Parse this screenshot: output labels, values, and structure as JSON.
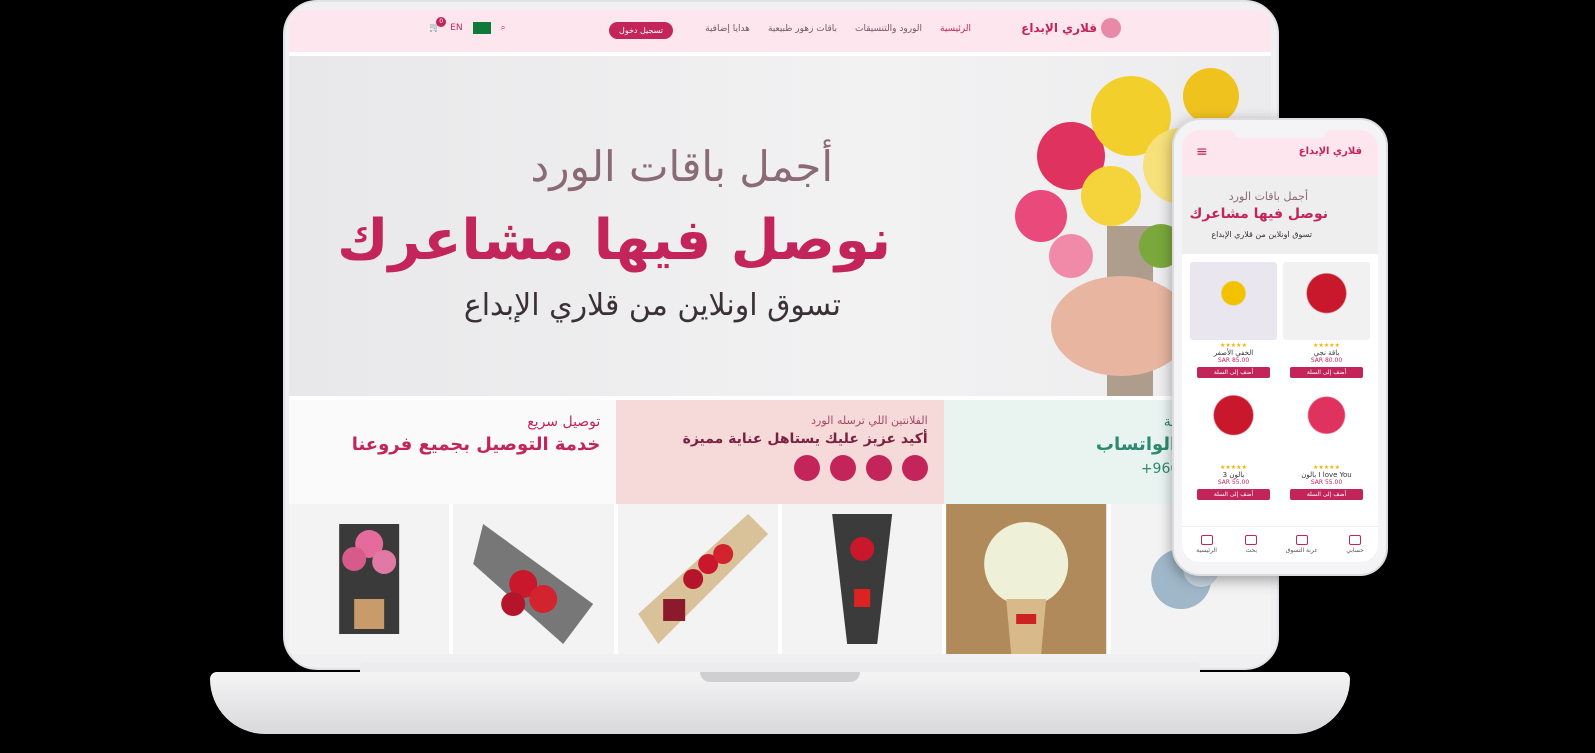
{
  "nav": {
    "logo": "قلاري الإبداع",
    "items": [
      "الرئيسية",
      "الورود والتنسيقات",
      "باقات زهور طبيعية",
      "هدايا إضافية"
    ],
    "register": "تسجيل دخول",
    "lang": "EN",
    "cart_count": "0"
  },
  "hero": {
    "line1": "أجمل باقات الورد",
    "line2": "نوصل فيها مشاعرك",
    "line3": "تسوق اونلاين من قلاري الإبداع"
  },
  "banners": [
    {
      "title": "توصيل سريع",
      "subtitle": "خدمة التوصيل بجميع فروعنا"
    },
    {
      "title": "الفلانتين اللي ترسله الورد",
      "subtitle": "أكيد عزيز عليك يستاهل عناية مميزة"
    },
    {
      "title": "الطلبات الخاصة",
      "subtitle": "معنا عبر الواتساب",
      "phone": "+966 50388888"
    }
  ],
  "phone": {
    "logo": "قلاري الإبداع",
    "hero": {
      "line1": "أجمل باقات الورد",
      "line2": "نوصل فيها مشاعرك",
      "line3": "تسوق اونلاين من قلاري الإبداع"
    },
    "products": [
      {
        "name": "باقة نجي",
        "price": "SAR 80.00",
        "button": "أضف إلى السلة",
        "stars": "★★★★★"
      },
      {
        "name": "الخفي الأصفر",
        "price": "SAR 85.00",
        "button": "أضف إلى السلة",
        "stars": "★★★★★"
      },
      {
        "name": "I love You بالون",
        "price": "SAR 55.00",
        "button": "أضف إلى السلة",
        "stars": "★★★★★"
      },
      {
        "name": "بالون 3",
        "price": "SAR 55.00",
        "button": "أضف إلى السلة",
        "stars": "★★★★★"
      }
    ],
    "tabs": [
      "حسابي",
      "عربة التسوق",
      "بحث",
      "الرئيسية"
    ]
  },
  "colors": {
    "brand": "#c3245a",
    "nav_bg": "#fde6ee"
  }
}
